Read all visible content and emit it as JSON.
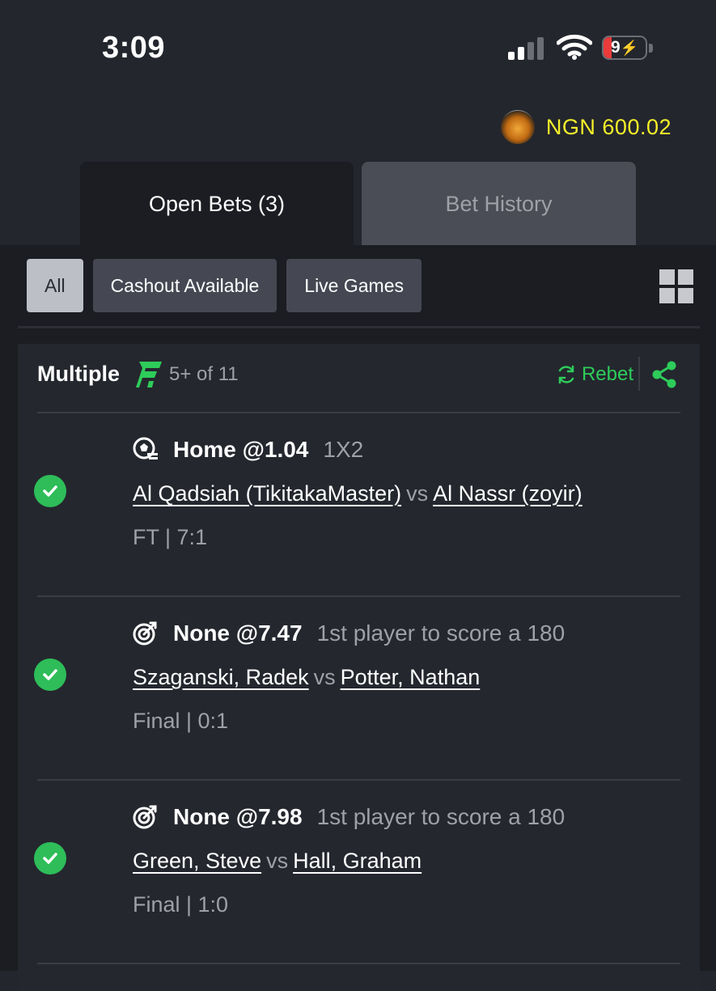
{
  "status_bar": {
    "time": "3:09",
    "battery_level": "9",
    "battery_fraction": 0.09,
    "signal_bars_active": 2
  },
  "balance": {
    "amount": "NGN 600.02",
    "color": "#f5ef2a"
  },
  "tabs": [
    {
      "label": "Open Bets (3)",
      "active": true
    },
    {
      "label": "Bet History",
      "active": false
    }
  ],
  "filters": [
    {
      "label": "All",
      "active": true
    },
    {
      "label": "Cashout Available",
      "active": false
    },
    {
      "label": "Live Games",
      "active": false
    }
  ],
  "card": {
    "title": "Multiple",
    "subtitle": "5+ of 11",
    "rebet_label": "Rebet",
    "accent_color": "#2ecc5a",
    "bets": [
      {
        "sport_icon": "soccer-icon",
        "pick": "Home @1.04",
        "market": "1X2",
        "home": "Al Qadsiah (TikitakaMaster)",
        "vs": "vs",
        "away": "Al Nassr (zoyir)",
        "result": "FT | 7:1",
        "won": true
      },
      {
        "sport_icon": "darts-icon",
        "pick": "None @7.47",
        "market": "1st player to score a 180",
        "home": "Szaganski, Radek",
        "vs": "vs",
        "away": "Potter, Nathan",
        "result": "Final | 0:1",
        "won": true
      },
      {
        "sport_icon": "darts-icon",
        "pick": "None @7.98",
        "market": "1st player to score a 180",
        "home": "Green, Steve",
        "vs": "vs",
        "away": "Hall, Graham",
        "result": "Final | 1:0",
        "won": true
      }
    ]
  }
}
